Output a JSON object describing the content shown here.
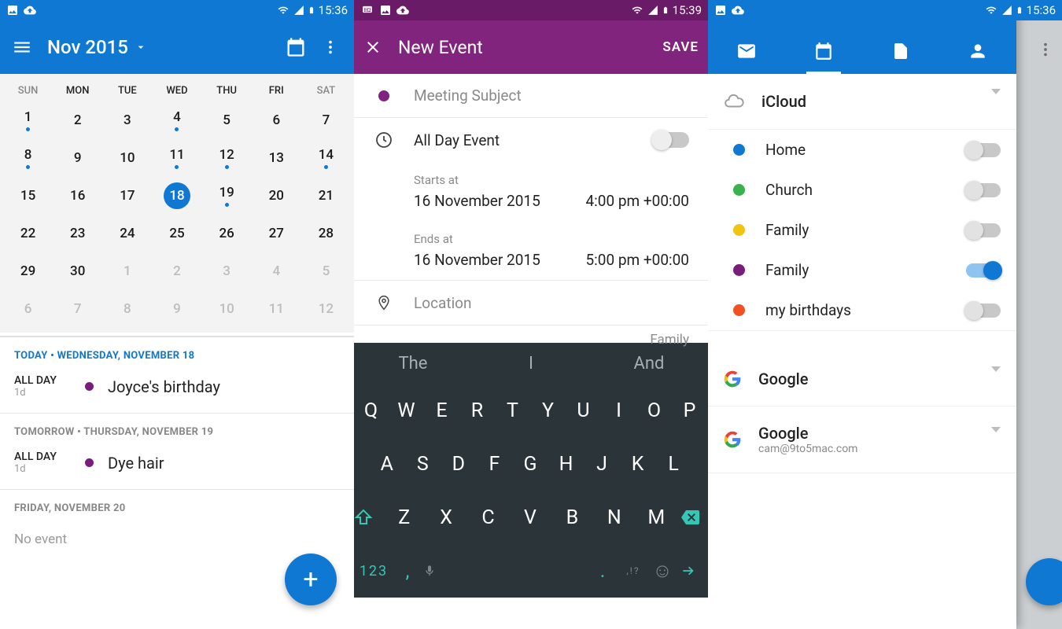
{
  "statusbar_time_1": "15:36",
  "statusbar_time_2": "15:39",
  "statusbar_time_3": "15:36",
  "screen1": {
    "month_title": "Nov 2015",
    "today_chip_day": "18",
    "weekdays": [
      "SUN",
      "MON",
      "TUE",
      "WED",
      "THU",
      "FRI",
      "SAT"
    ],
    "grid": [
      [
        {
          "n": "1",
          "dot": true
        },
        {
          "n": "2"
        },
        {
          "n": "3"
        },
        {
          "n": "4",
          "dot": true
        },
        {
          "n": "5"
        },
        {
          "n": "6"
        },
        {
          "n": "7"
        }
      ],
      [
        {
          "n": "8",
          "dot": true
        },
        {
          "n": "9"
        },
        {
          "n": "10"
        },
        {
          "n": "11",
          "dot": true
        },
        {
          "n": "12",
          "dot": true
        },
        {
          "n": "13"
        },
        {
          "n": "14",
          "dot": true
        }
      ],
      [
        {
          "n": "15"
        },
        {
          "n": "16"
        },
        {
          "n": "17"
        },
        {
          "n": "18",
          "today": true
        },
        {
          "n": "19",
          "dot": true
        },
        {
          "n": "20"
        },
        {
          "n": "21"
        }
      ],
      [
        {
          "n": "22"
        },
        {
          "n": "23"
        },
        {
          "n": "24"
        },
        {
          "n": "25"
        },
        {
          "n": "26"
        },
        {
          "n": "27"
        },
        {
          "n": "28"
        }
      ],
      [
        {
          "n": "29"
        },
        {
          "n": "30"
        },
        {
          "n": "1",
          "grey": true
        },
        {
          "n": "2",
          "grey": true
        },
        {
          "n": "3",
          "grey": true
        },
        {
          "n": "4",
          "grey": true
        },
        {
          "n": "5",
          "grey": true
        }
      ],
      [
        {
          "n": "6",
          "grey": true
        },
        {
          "n": "7",
          "grey": true
        },
        {
          "n": "8",
          "grey": true
        },
        {
          "n": "9",
          "grey": true
        },
        {
          "n": "10",
          "grey": true
        },
        {
          "n": "11",
          "grey": true
        },
        {
          "n": "12",
          "grey": true
        }
      ]
    ],
    "list": {
      "today_header": "TODAY • WEDNESDAY, NOVEMBER 18",
      "today_all_day": "ALL DAY",
      "today_duration": "1d",
      "today_event": "Joyce's birthday",
      "tomorrow_header": "TOMORROW • THURSDAY, NOVEMBER 19",
      "tomorrow_all_day": "ALL DAY",
      "tomorrow_duration": "1d",
      "tomorrow_event": "Dye hair",
      "friday_header": "FRIDAY, NOVEMBER 20",
      "no_event": "No event"
    }
  },
  "screen2": {
    "title": "New Event",
    "save": "SAVE",
    "subject_placeholder": "Meeting Subject",
    "all_day_label": "All Day Event",
    "starts_caption": "Starts at",
    "starts_date": "16 November 2015",
    "starts_time": "4:00 pm +00:00",
    "ends_caption": "Ends at",
    "ends_date": "16 November 2015",
    "ends_time": "5:00 pm +00:00",
    "location_placeholder": "Location",
    "calendar_peek": "Family",
    "keyboard": {
      "suggestions": [
        "The",
        "I",
        "And"
      ],
      "row1": [
        "Q",
        "W",
        "E",
        "R",
        "T",
        "Y",
        "U",
        "I",
        "O",
        "P"
      ],
      "row2": [
        "A",
        "S",
        "D",
        "F",
        "G",
        "H",
        "J",
        "K",
        "L"
      ],
      "row3": [
        "Z",
        "X",
        "C",
        "V",
        "B",
        "N",
        "M"
      ],
      "numeric_key": "123"
    }
  },
  "screen3": {
    "accounts": [
      {
        "name": "iCloud",
        "icon": "cloud",
        "calendars": [
          {
            "label": "Home",
            "color": "#0F78D3",
            "on": false
          },
          {
            "label": "Church",
            "color": "#37B24D",
            "on": false
          },
          {
            "label": "Family",
            "color": "#F1C40F",
            "on": false
          },
          {
            "label": "Family",
            "color": "#7A1C7A",
            "on": true
          },
          {
            "label": "my birthdays",
            "color": "#F25022",
            "on": false
          }
        ]
      },
      {
        "name": "Google",
        "icon": "google"
      },
      {
        "name": "Google",
        "sub": "cam@9to5mac.com",
        "icon": "google"
      }
    ]
  }
}
